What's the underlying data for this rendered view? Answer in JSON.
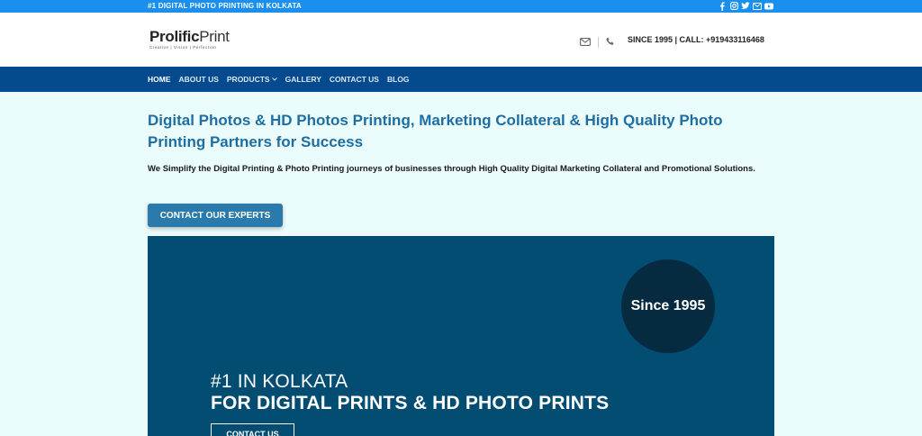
{
  "topbar": {
    "message": "#1 DIGITAL PHOTO PRINTING IN KOLKATA",
    "social": [
      "facebook-icon",
      "instagram-icon",
      "twitter-icon",
      "email-icon",
      "youtube-icon"
    ]
  },
  "header": {
    "logo_name_1": "Prolific",
    "logo_name_2": "Print",
    "logo_tagline": "Creative  |  Vision  |  Perfection",
    "contact": "SINCE 1995 | CALL: +919433116468"
  },
  "nav": {
    "items": [
      {
        "label": "HOME",
        "active": true
      },
      {
        "label": "ABOUT US"
      },
      {
        "label": "PRODUCTS"
      },
      {
        "label": "GALLERY"
      },
      {
        "label": "CONTACT US"
      },
      {
        "label": "BLOG"
      }
    ]
  },
  "hero": {
    "title": "Digital Photos & HD Photos Printing, Marketing Collateral & High Quality Photo Printing Partners for Success",
    "description": "We Simplify the Digital Printing & Photo Printing journeys of businesses through High Quality Digital Marketing Collateral and Promotional Solutions.",
    "cta_label": "CONTACT OUR EXPERTS"
  },
  "banner": {
    "badge": "Since 1995",
    "line1": "#1 IN KOLKATA",
    "line2": "FOR DIGITAL PRINTS & HD PHOTO PRINTS",
    "button_label": "CONTACT US"
  },
  "colors": {
    "topbar": "#1a8ff0",
    "nav": "#034a8e",
    "title": "#1e6ea3",
    "cta": "#2a7bab",
    "banner": "#034d73",
    "badge": "#062b40",
    "page_bg": "#eafcfc"
  }
}
